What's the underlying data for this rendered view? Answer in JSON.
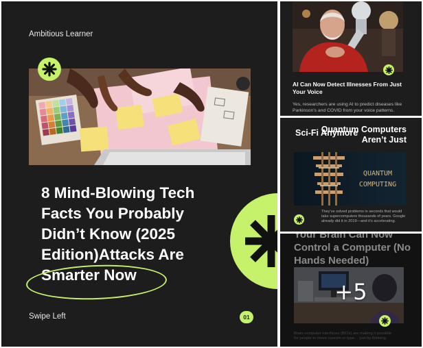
{
  "main_card": {
    "brand": "Ambitious Learner",
    "headline_lines": [
      "8 Mind-Blowing Tech",
      "Facts You Probably",
      "Didn’t Know (2025",
      "Edition)Attacks Are",
      "Smarter Now"
    ],
    "swipe_label": "Swipe Left",
    "page_number": "01"
  },
  "side_cards": [
    {
      "title": "AI Can Now Detect Illnesses From Just Your Voice",
      "body": "Yes, researchers are using AI to predict diseases like Parkinson’s and COVID from your voice patterns."
    },
    {
      "heading": "Quantum Computers Aren’t Just",
      "subheading": "Sci-Fi Anymore",
      "image_text": [
        "QUANTUM",
        "COMPUTING"
      ],
      "body": "They’ve solved problems in seconds that would take supercomputers thousands of years. Google already did it in 2019—and it’s accelerating."
    },
    {
      "heading": "Your Brain Can Now Control a Computer (No Hands Needed)",
      "body": "Brain-computer interfaces (BCIs) are making it possible for people to move cursors or type… just by thinking."
    }
  ],
  "more_count": "+5",
  "colors": {
    "background": "#1d1d1d",
    "accent": "#c6f26b",
    "text": "#ffffff"
  },
  "icons": [
    "asterisk-icon"
  ]
}
